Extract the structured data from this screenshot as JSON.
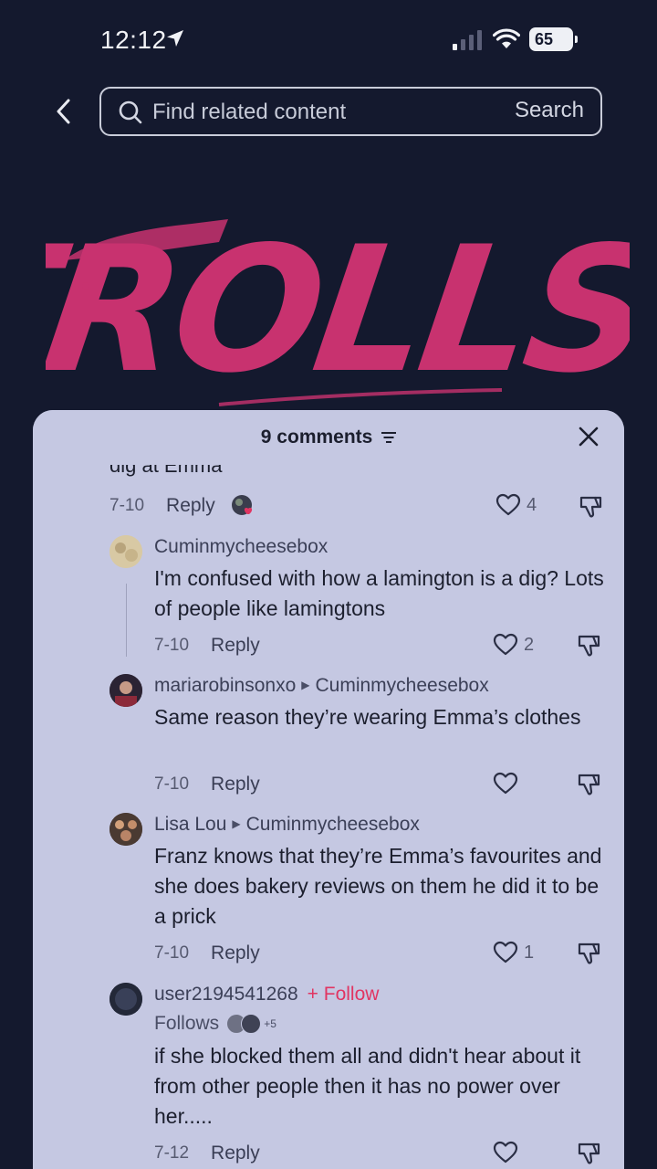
{
  "status_bar": {
    "time": "12:12",
    "battery": "65"
  },
  "search": {
    "placeholder": "Find related content",
    "button_label": "Search"
  },
  "video": {
    "title_art_text": "TROLLS."
  },
  "comments_panel": {
    "count_label": "9 comments",
    "partial_comment": {
      "text": "dig at Emma",
      "date": "7-10",
      "reply_label": "Reply",
      "likes": "4"
    },
    "items": [
      {
        "username": "Cuminmycheesebox",
        "reply_to": "",
        "text": "I'm confused with how a lamington is a dig? Lots of people like lamingtons",
        "date": "7-10",
        "reply_label": "Reply",
        "likes": "2"
      },
      {
        "username": "mariarobinsonxo",
        "reply_to": "Cuminmycheesebox",
        "text": "Same reason they’re wearing Emma’s clothes",
        "date": "7-10",
        "reply_label": "Reply",
        "likes": ""
      },
      {
        "username": "Lisa Lou",
        "reply_to": "Cuminmycheesebox",
        "text": "Franz knows that they’re Emma’s favourites and she does bakery reviews on them he did it to be a prick",
        "date": "7-10",
        "reply_label": "Reply",
        "likes": "1"
      },
      {
        "username": "user2194541268",
        "follow_label": "+ Follow",
        "follows_label": "Follows",
        "follows_more": "+5",
        "text": "if she blocked them all and didn't hear about it from other people then it has no power over her.....",
        "date": "7-12",
        "reply_label": "Reply",
        "likes": ""
      }
    ]
  },
  "colors": {
    "background": "#14192e",
    "sheet": "#c5c8e2",
    "accent_pink": "#e13562",
    "title_pink": "#c8326f"
  }
}
